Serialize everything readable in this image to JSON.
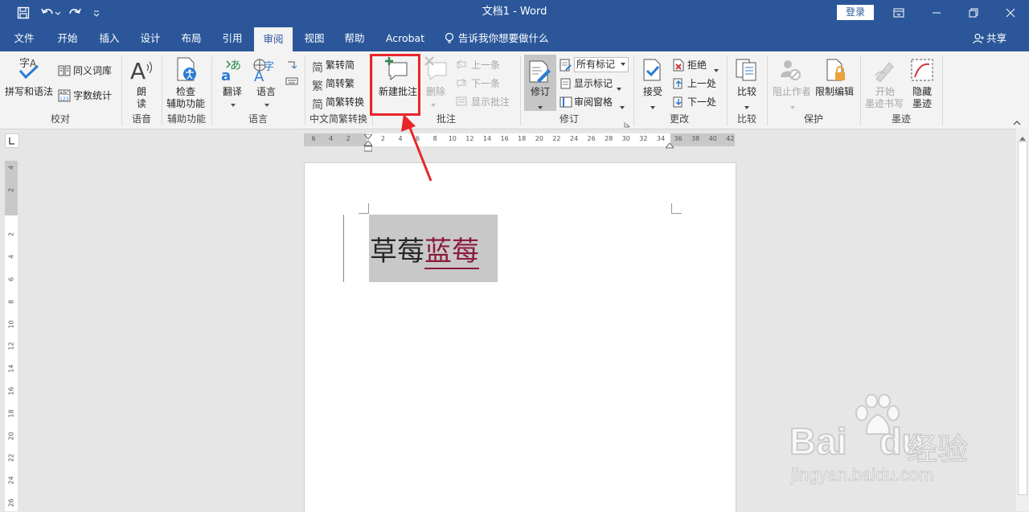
{
  "window": {
    "title": "文档1",
    "app": "Word",
    "sep": "-",
    "login": "登录"
  },
  "tabs": [
    "文件",
    "开始",
    "插入",
    "设计",
    "布局",
    "引用",
    "审阅",
    "视图",
    "帮助",
    "Acrobat"
  ],
  "tell_me": "告诉我你想要做什么",
  "share": "共享",
  "ribbon": {
    "proof": {
      "spell": "拼写和语法",
      "thesaurus": "同义词库",
      "wordcount": "字数统计",
      "label": "校对"
    },
    "speech": {
      "read1": "朗",
      "read2": "读",
      "label": "语音"
    },
    "access": {
      "check1": "检查",
      "check2": "辅助功能",
      "label": "辅助功能"
    },
    "lang": {
      "translate": "翻译",
      "language": "语言",
      "label": "语言"
    },
    "chinese": {
      "t2s": "繁转简",
      "s2t": "简转繁",
      "convert": "简繁转换",
      "label": "中文简繁转换"
    },
    "comments": {
      "new": "新建批注",
      "delete": "删除",
      "prev": "上一条",
      "next": "下一条",
      "show": "显示批注",
      "label": "批注"
    },
    "tracking": {
      "track": "修订",
      "markup": "所有标记",
      "show_markup": "显示标记",
      "pane": "审阅窗格",
      "label": "修订"
    },
    "changes": {
      "accept": "接受",
      "reject": "拒绝",
      "prev": "上一处",
      "next": "下一处",
      "label": "更改"
    },
    "compare": {
      "compare": "比较",
      "label": "比较"
    },
    "protect": {
      "block": "阻止作者",
      "restrict": "限制编辑",
      "label": "保护"
    },
    "ink": {
      "start1": "开始",
      "start2": "墨迹书写",
      "hide1": "隐藏",
      "hide2": "墨迹",
      "label": "墨迹"
    }
  },
  "ruler_h": [
    "6",
    "4",
    "2",
    "",
    "2",
    "4",
    "6",
    "8",
    "10",
    "12",
    "14",
    "16",
    "18",
    "20",
    "22",
    "24",
    "26",
    "28",
    "30",
    "32",
    "34",
    "36",
    "38",
    "40",
    "42"
  ],
  "ruler_v": [
    "4",
    "2",
    "",
    "2",
    "4",
    "6",
    "8",
    "10",
    "12",
    "14",
    "16",
    "18",
    "20",
    "22",
    "24",
    "26"
  ],
  "document": {
    "text1": "草莓",
    "text2": "蓝莓"
  },
  "watermark": {
    "brand": "Bai",
    "du": "du",
    "cn": "经验",
    "url": "jingyan.baidu.com"
  },
  "colors": {
    "brand": "#2b579a",
    "highlight": "#c8c8c8",
    "insert_text": "#8b1a3c",
    "annotation": "#e8262a"
  }
}
